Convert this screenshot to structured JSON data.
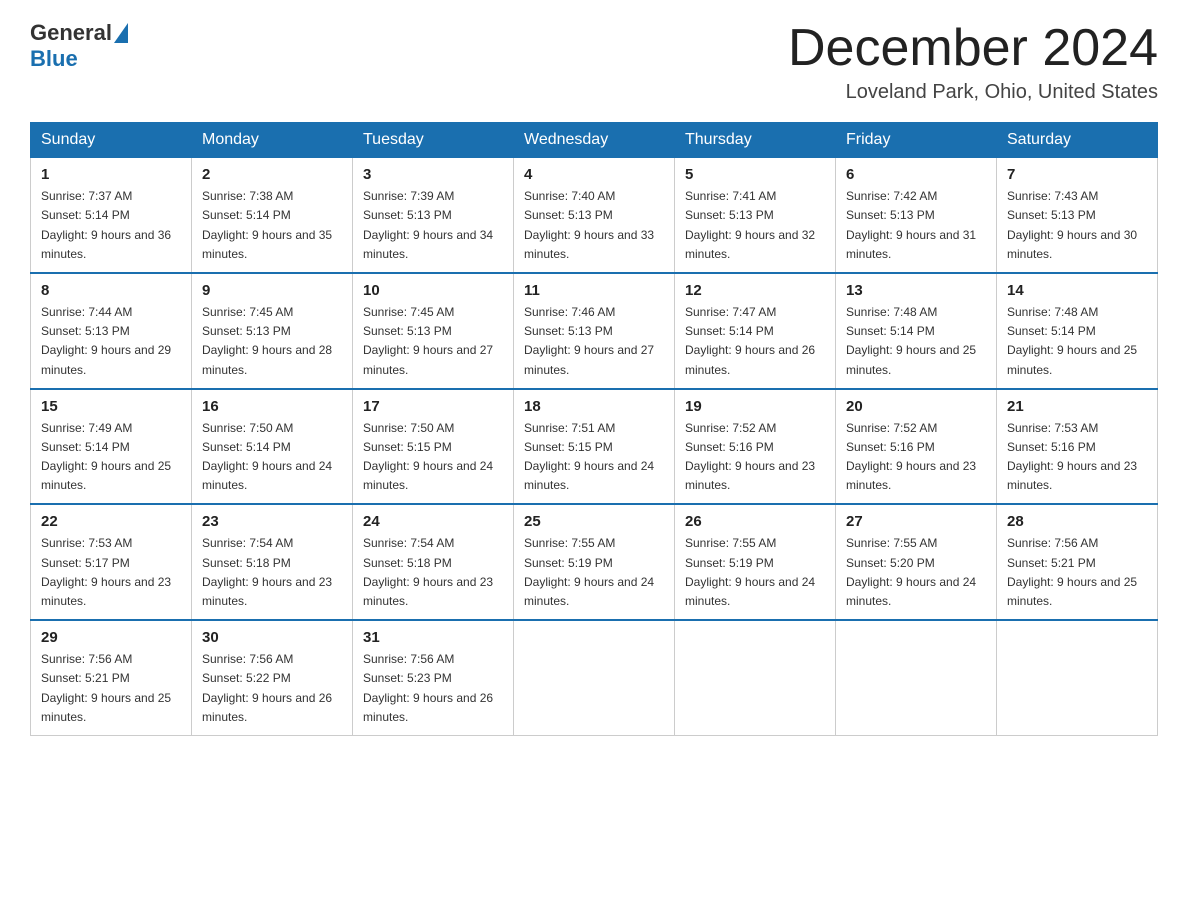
{
  "header": {
    "logo_text_general": "General",
    "logo_text_blue": "Blue",
    "title": "December 2024",
    "location": "Loveland Park, Ohio, United States"
  },
  "weekdays": [
    "Sunday",
    "Monday",
    "Tuesday",
    "Wednesday",
    "Thursday",
    "Friday",
    "Saturday"
  ],
  "weeks": [
    [
      {
        "day": "1",
        "sunrise": "7:37 AM",
        "sunset": "5:14 PM",
        "daylight": "9 hours and 36 minutes."
      },
      {
        "day": "2",
        "sunrise": "7:38 AM",
        "sunset": "5:14 PM",
        "daylight": "9 hours and 35 minutes."
      },
      {
        "day": "3",
        "sunrise": "7:39 AM",
        "sunset": "5:13 PM",
        "daylight": "9 hours and 34 minutes."
      },
      {
        "day": "4",
        "sunrise": "7:40 AM",
        "sunset": "5:13 PM",
        "daylight": "9 hours and 33 minutes."
      },
      {
        "day": "5",
        "sunrise": "7:41 AM",
        "sunset": "5:13 PM",
        "daylight": "9 hours and 32 minutes."
      },
      {
        "day": "6",
        "sunrise": "7:42 AM",
        "sunset": "5:13 PM",
        "daylight": "9 hours and 31 minutes."
      },
      {
        "day": "7",
        "sunrise": "7:43 AM",
        "sunset": "5:13 PM",
        "daylight": "9 hours and 30 minutes."
      }
    ],
    [
      {
        "day": "8",
        "sunrise": "7:44 AM",
        "sunset": "5:13 PM",
        "daylight": "9 hours and 29 minutes."
      },
      {
        "day": "9",
        "sunrise": "7:45 AM",
        "sunset": "5:13 PM",
        "daylight": "9 hours and 28 minutes."
      },
      {
        "day": "10",
        "sunrise": "7:45 AM",
        "sunset": "5:13 PM",
        "daylight": "9 hours and 27 minutes."
      },
      {
        "day": "11",
        "sunrise": "7:46 AM",
        "sunset": "5:13 PM",
        "daylight": "9 hours and 27 minutes."
      },
      {
        "day": "12",
        "sunrise": "7:47 AM",
        "sunset": "5:14 PM",
        "daylight": "9 hours and 26 minutes."
      },
      {
        "day": "13",
        "sunrise": "7:48 AM",
        "sunset": "5:14 PM",
        "daylight": "9 hours and 25 minutes."
      },
      {
        "day": "14",
        "sunrise": "7:48 AM",
        "sunset": "5:14 PM",
        "daylight": "9 hours and 25 minutes."
      }
    ],
    [
      {
        "day": "15",
        "sunrise": "7:49 AM",
        "sunset": "5:14 PM",
        "daylight": "9 hours and 25 minutes."
      },
      {
        "day": "16",
        "sunrise": "7:50 AM",
        "sunset": "5:14 PM",
        "daylight": "9 hours and 24 minutes."
      },
      {
        "day": "17",
        "sunrise": "7:50 AM",
        "sunset": "5:15 PM",
        "daylight": "9 hours and 24 minutes."
      },
      {
        "day": "18",
        "sunrise": "7:51 AM",
        "sunset": "5:15 PM",
        "daylight": "9 hours and 24 minutes."
      },
      {
        "day": "19",
        "sunrise": "7:52 AM",
        "sunset": "5:16 PM",
        "daylight": "9 hours and 23 minutes."
      },
      {
        "day": "20",
        "sunrise": "7:52 AM",
        "sunset": "5:16 PM",
        "daylight": "9 hours and 23 minutes."
      },
      {
        "day": "21",
        "sunrise": "7:53 AM",
        "sunset": "5:16 PM",
        "daylight": "9 hours and 23 minutes."
      }
    ],
    [
      {
        "day": "22",
        "sunrise": "7:53 AM",
        "sunset": "5:17 PM",
        "daylight": "9 hours and 23 minutes."
      },
      {
        "day": "23",
        "sunrise": "7:54 AM",
        "sunset": "5:18 PM",
        "daylight": "9 hours and 23 minutes."
      },
      {
        "day": "24",
        "sunrise": "7:54 AM",
        "sunset": "5:18 PM",
        "daylight": "9 hours and 23 minutes."
      },
      {
        "day": "25",
        "sunrise": "7:55 AM",
        "sunset": "5:19 PM",
        "daylight": "9 hours and 24 minutes."
      },
      {
        "day": "26",
        "sunrise": "7:55 AM",
        "sunset": "5:19 PM",
        "daylight": "9 hours and 24 minutes."
      },
      {
        "day": "27",
        "sunrise": "7:55 AM",
        "sunset": "5:20 PM",
        "daylight": "9 hours and 24 minutes."
      },
      {
        "day": "28",
        "sunrise": "7:56 AM",
        "sunset": "5:21 PM",
        "daylight": "9 hours and 25 minutes."
      }
    ],
    [
      {
        "day": "29",
        "sunrise": "7:56 AM",
        "sunset": "5:21 PM",
        "daylight": "9 hours and 25 minutes."
      },
      {
        "day": "30",
        "sunrise": "7:56 AM",
        "sunset": "5:22 PM",
        "daylight": "9 hours and 26 minutes."
      },
      {
        "day": "31",
        "sunrise": "7:56 AM",
        "sunset": "5:23 PM",
        "daylight": "9 hours and 26 minutes."
      },
      null,
      null,
      null,
      null
    ]
  ]
}
